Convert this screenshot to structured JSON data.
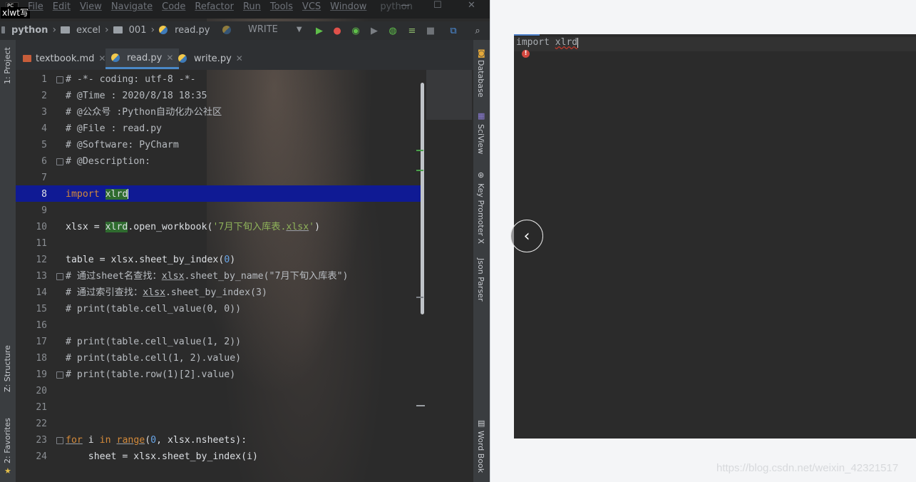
{
  "window": {
    "app_badge": "PC",
    "tooltip_tag": "xlwt写",
    "menu": [
      "File",
      "Edit",
      "View",
      "Navigate",
      "Code",
      "Refactor",
      "Run",
      "Tools",
      "VCS",
      "Window"
    ],
    "project_menu": "python"
  },
  "navbar": {
    "breadcrumbs": [
      "python",
      "excel",
      "001",
      "read.py"
    ],
    "run_config": "WRITE"
  },
  "tabs": [
    {
      "label": "textbook.md",
      "type": "md",
      "active": false
    },
    {
      "label": "read.py",
      "type": "py",
      "active": true
    },
    {
      "label": "write.py",
      "type": "py",
      "active": false
    }
  ],
  "left_tools": {
    "project": "1: Project",
    "structure": "Z: Structure",
    "favorites": "2: Favorites"
  },
  "right_tools": {
    "database": "Database",
    "sciview": "SciView",
    "key_promoter": "Key Promoter X",
    "json_parser": "Json Parser",
    "word_book": "Word Book"
  },
  "editor": {
    "current_line": 8,
    "line_numbers": [
      "1",
      "2",
      "3",
      "4",
      "5",
      "6",
      "7",
      "8",
      "9",
      "10",
      "11",
      "12",
      "13",
      "14",
      "15",
      "16",
      "17",
      "18",
      "19",
      "20",
      "21",
      "22",
      "23",
      "24"
    ]
  },
  "right_panel": {
    "code_kw": "import",
    "code_mod": "xlrd"
  },
  "overlay": {
    "back_glyph": "‹",
    "watermark": "https://blog.csdn.net/weixin_42321517"
  },
  "colors": {
    "accent": "#4a88c7",
    "current_line_highlight": "#0f1a94",
    "error": "#d3473f"
  }
}
